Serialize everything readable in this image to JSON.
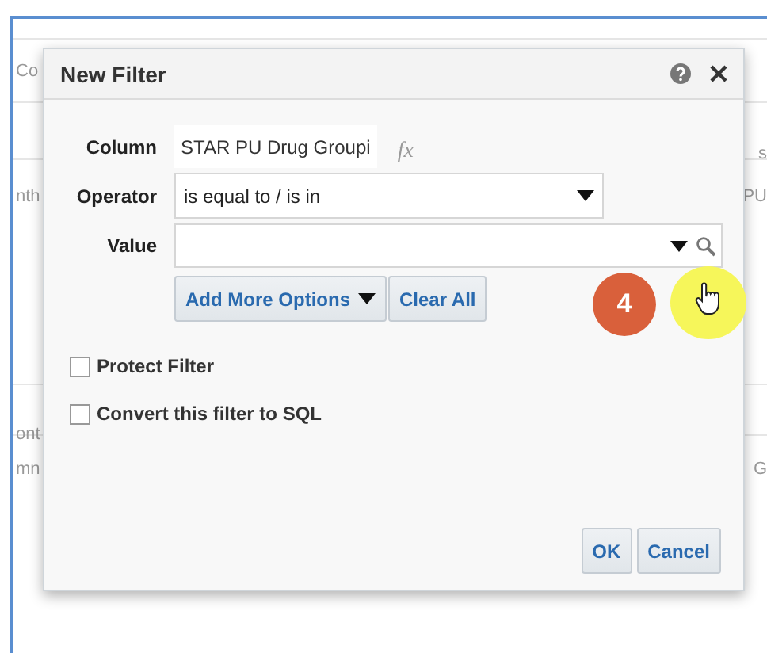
{
  "background": {
    "rows": [
      {
        "left": "Co",
        "right": ""
      },
      {
        "left": "",
        "right": "s"
      },
      {
        "left": "nth",
        "right": "PU"
      },
      {
        "left": "ont",
        "right": ""
      },
      {
        "left": "mn",
        "right": "G"
      }
    ]
  },
  "dialog": {
    "title": "New Filter",
    "column": {
      "label": "Column",
      "value": "STAR PU Drug Groupi",
      "formula": "fx"
    },
    "operator": {
      "label": "Operator",
      "value": "is equal to / is in"
    },
    "value": {
      "label": "Value"
    },
    "option_buttons": [
      "Add More Options",
      "Clear All"
    ],
    "checkboxes": [
      {
        "label": "Protect Filter",
        "checked": false
      },
      {
        "label": "Convert this filter to SQL",
        "checked": false
      }
    ],
    "buttons": [
      "OK",
      "Cancel"
    ]
  },
  "annotation": {
    "step": "4"
  }
}
